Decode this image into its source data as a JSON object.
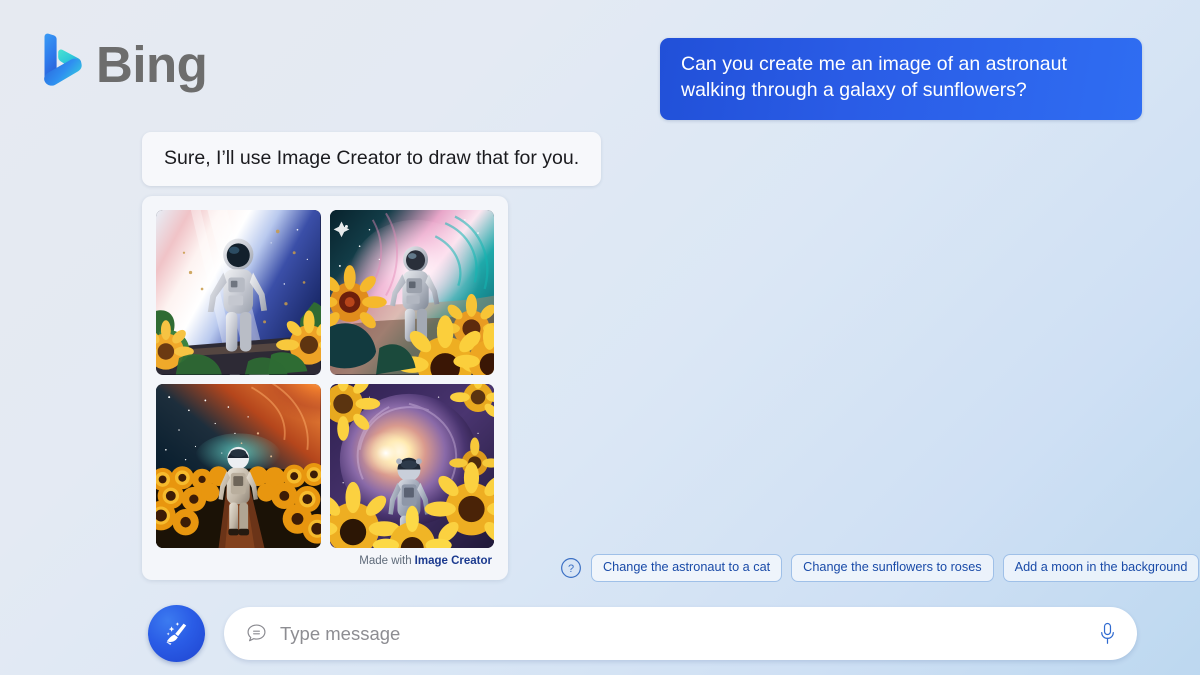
{
  "brand": {
    "name": "Bing",
    "logo_icon": "bing-b-logo-icon",
    "logo_gradient_start": "#2e7ef0",
    "logo_gradient_end": "#27d4c8"
  },
  "conversation": {
    "user_message": {
      "text": "Can you create me an image of an astronaut walking through a galaxy of sunflowers?",
      "bubble_color": "#2a5ce6",
      "text_color": "#ffffff"
    },
    "bot_message": {
      "text": "Sure, I’ll use Image Creator to draw that for you.",
      "bubble_color": "#f7f8fb",
      "text_color": "#1b1b1f"
    }
  },
  "image_card": {
    "images": [
      {
        "alt": "Astronaut standing before a pale pink and blue galaxy with sunflowers and green leaves",
        "sky_top": "#f4c9cf",
        "sky_mid": "#ffffff",
        "sky_right": "#2f4fae",
        "accent": "#7fb3ff"
      },
      {
        "alt": "Astronaut walking toward a teal and pink nebula framed by large sunflowers",
        "sky_top": "#0e3540",
        "sky_mid": "#f2b6d8",
        "sky_right": "#18b0ac",
        "accent": "#ffc62e"
      },
      {
        "alt": "Astronaut walking away down a dirt path through a sunflower field under an orange nebula",
        "sky_top": "#0a1524",
        "sky_mid": "#e05a1c",
        "sky_right": "#c94a28",
        "accent": "#f5a623"
      },
      {
        "alt": "Astronaut walking into a purple spiral galaxy surrounded by sunflowers",
        "sky_top": "#3a2258",
        "sky_mid": "#fff3c8",
        "sky_right": "#6b4aa0",
        "accent": "#ffd233"
      }
    ],
    "footer": {
      "made_with": "Made with",
      "creator_name": "Image Creator",
      "creator_color": "#1b3a8f"
    }
  },
  "suggestions": {
    "help_icon": "question-mark-circle-icon",
    "chips": [
      {
        "label": "Change the astronaut to a cat"
      },
      {
        "label": "Change the sunflowers to roses"
      },
      {
        "label": "Add a moon in the background"
      }
    ],
    "chip_text_color": "#1a4ba8",
    "chip_border_color": "#9fc0e8"
  },
  "composer": {
    "new_topic_icon": "broom-sparkle-icon",
    "new_topic_color": "#2a5ce6",
    "compose_icon": "chat-bubble-lines-icon",
    "input_placeholder": "Type message",
    "input_value": "",
    "mic_icon": "microphone-icon",
    "mic_color": "#2f6ad0"
  },
  "theme": {
    "background_start": "#e6eaf1",
    "background_end": "#bdd8f0"
  }
}
